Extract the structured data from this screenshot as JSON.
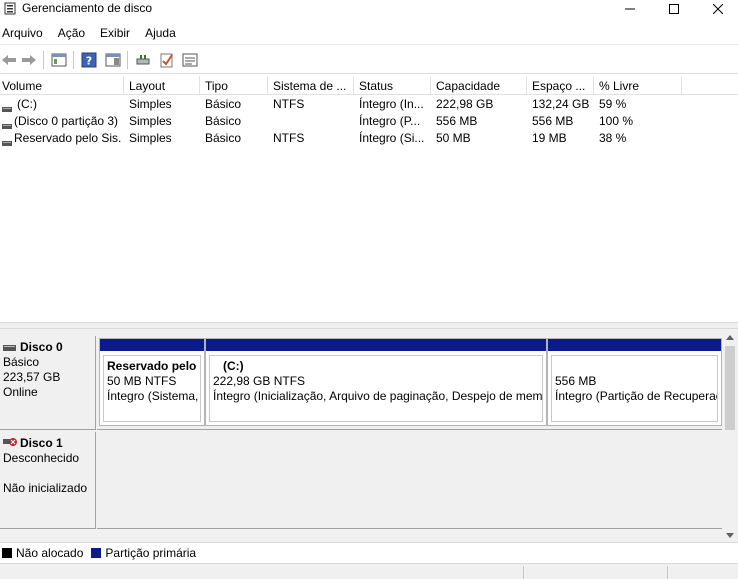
{
  "window": {
    "title": "Gerenciamento de disco",
    "icon": "disk-management-icon"
  },
  "menu": [
    "Arquivo",
    "Ação",
    "Exibir",
    "Ajuda"
  ],
  "toolbar": {
    "buttons": [
      "back-arrow-icon",
      "forward-arrow-icon",
      "properties-panel-icon",
      "help-icon",
      "show-hide-pane-icon",
      "connect-drive-icon",
      "checkmark-icon",
      "settings-list-icon"
    ]
  },
  "volumes": {
    "headers": [
      "Volume",
      "Layout",
      "Tipo",
      "Sistema de ...",
      "Status",
      "Capacidade",
      "Espaço ...",
      "% Livre"
    ],
    "rows": [
      [
        "(C:)",
        "Simples",
        "Básico",
        "NTFS",
        "Íntegro (In...",
        "222,98 GB",
        "132,24 GB",
        "59 %"
      ],
      [
        "(Disco 0 partição 3)",
        "Simples",
        "Básico",
        "",
        "Íntegro (P...",
        "556 MB",
        "556 MB",
        "100 %"
      ],
      [
        "Reservado pelo Sis...",
        "Simples",
        "Básico",
        "NTFS",
        "Íntegro (Si...",
        "50 MB",
        "19 MB",
        "38 %"
      ]
    ]
  },
  "disks": [
    {
      "name": "Disco 0",
      "type": "Básico",
      "size": "223,57 GB",
      "status": "Online",
      "partitions": [
        {
          "name": "Reservado pelo Sistema",
          "detail": "50 MB NTFS",
          "status": "Íntegro (Sistema, Ativo, Partição Primária)"
        },
        {
          "name": "(C:)",
          "detail": "222,98 GB NTFS",
          "status": "Íntegro (Inicialização, Arquivo de paginação, Despejo de memória, Partição Primária)"
        },
        {
          "name": "",
          "detail": "556 MB",
          "status": "Íntegro (Partição de Recuperação)"
        }
      ]
    },
    {
      "name": "Disco 1",
      "type": "Desconhecido",
      "size": "",
      "status": "Não inicializado"
    }
  ],
  "legend": [
    {
      "label": "Não alocado",
      "color": "#000000"
    },
    {
      "label": "Partição primária",
      "color": "#0b1a8c"
    }
  ],
  "colors": {
    "partition_bar": "#0b1a8c",
    "panel_bg": "#f0f0f0"
  }
}
